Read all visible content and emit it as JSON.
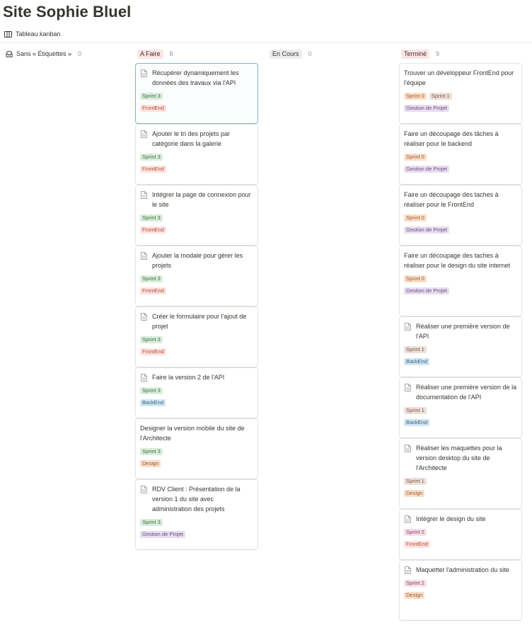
{
  "page": {
    "title": "Site Sophie Bluel",
    "view_tab": "Tableau kanban"
  },
  "columns": [
    {
      "label": "Sans « Étiquettes »",
      "count": "0",
      "bg": "transparent",
      "fg": "#37352f"
    },
    {
      "label": "A Faire",
      "count": "8",
      "bg": "#fbe4e4",
      "fg": "#37352f"
    },
    {
      "label": "En Cours",
      "count": "0",
      "bg": "#ebeced",
      "fg": "#37352f"
    },
    {
      "label": "Terminé",
      "count": "9",
      "bg": "#fbe4e4",
      "fg": "#37352f"
    }
  ],
  "tag_colors": {
    "Sprint 3": {
      "bg": "#dbeddb",
      "fg": "#3a6e40"
    },
    "Sprint 0": {
      "bg": "#fadec9",
      "fg": "#9a5a2a"
    },
    "Sprint 1": {
      "bg": "#eee0da",
      "fg": "#7a5a4a"
    },
    "Sprint 2": {
      "bg": "#f5e0e9",
      "fg": "#8a3e5e"
    },
    "FrontEnd": {
      "bg": "#ffe2dd",
      "fg": "#b04a3e"
    },
    "BackEnd": {
      "bg": "#d3e5ef",
      "fg": "#2e6485"
    },
    "Design": {
      "bg": "#fadec9",
      "fg": "#9a5a2a"
    },
    "Gestion de Projet": {
      "bg": "#e8deee",
      "fg": "#6b4a86"
    }
  },
  "todo_cards": [
    {
      "title": "Récupérer dynamiquement les données des travaux via l'API",
      "icon": true,
      "sprint": "Sprint 3",
      "labels": [
        "FrontEnd"
      ]
    },
    {
      "title": "Ajouter le tri des projets par catégorie dans la galerie",
      "icon": true,
      "sprint": "Sprint 3",
      "labels": [
        "FrontEnd"
      ]
    },
    {
      "title": "Intégrer la page de connexion pour le site",
      "icon": true,
      "sprint": "Sprint 3",
      "labels": [
        "FrontEnd"
      ]
    },
    {
      "title": "Ajouter la modale pour gérer les projets",
      "icon": true,
      "sprint": "Sprint 3",
      "labels": [
        "FrontEnd"
      ]
    },
    {
      "title": "Créer le formulaire pour l'ajout de projet",
      "icon": true,
      "sprint": "Sprint 3",
      "labels": [
        "FrontEnd"
      ]
    },
    {
      "title": "Faire la version 2 de l'API",
      "icon": true,
      "sprint": "Sprint 3",
      "labels": [
        "BackEnd"
      ]
    },
    {
      "title": "Designer la version mobile du site de l'Architecte",
      "icon": false,
      "sprint": "Sprint 3",
      "labels": [
        "Design"
      ]
    },
    {
      "title": "RDV Client : Présentation de la version 1 du site avec administration des projets",
      "icon": true,
      "sprint": "Sprint 3",
      "labels": [
        "Gestion de Projet"
      ]
    }
  ],
  "done_cards": [
    {
      "title": "Trouver un développeur FrontEnd pour l'équipe",
      "icon": false,
      "sprints": [
        "Sprint 0",
        "Sprint 1"
      ],
      "labels": [
        "Gestion de Projet"
      ]
    },
    {
      "title": "Faire un découpage des tâches à réaliser pour le backend",
      "icon": false,
      "sprints": [
        "Sprint 0"
      ],
      "labels": [
        "Gestion de Projet"
      ]
    },
    {
      "title": "Faire un découpage des taches à réaliser pour le FrontEnd",
      "icon": false,
      "sprints": [
        "Sprint 0"
      ],
      "labels": [
        "Gestion de Projet"
      ]
    },
    {
      "title": "Faire un découpage des taches à réaliser pour le design du site internet",
      "icon": false,
      "sprints": [
        "Sprint 0"
      ],
      "labels": [
        "Gestion de Projet"
      ]
    },
    {
      "title": "Réaliser une première version de l'API",
      "icon": true,
      "sprints": [
        "Sprint 1"
      ],
      "labels": [
        "BackEnd"
      ]
    },
    {
      "title": "Réaliser une première version de la documentation de l'API",
      "icon": true,
      "sprints": [
        "Sprint 1"
      ],
      "labels": [
        "BackEnd"
      ]
    },
    {
      "title": "Réaliser les maquettes pour la version desktop du site de l'Architecte",
      "icon": true,
      "sprints": [
        "Sprint 1"
      ],
      "labels": [
        "Design"
      ]
    },
    {
      "title": "Intégrer le design du site",
      "icon": true,
      "sprints": [
        "Sprint 2"
      ],
      "labels": [
        "FrontEnd"
      ]
    },
    {
      "title": "Maquetter l'administration du site",
      "icon": true,
      "sprints": [
        "Sprint 2"
      ],
      "labels": [
        "Design"
      ]
    }
  ]
}
